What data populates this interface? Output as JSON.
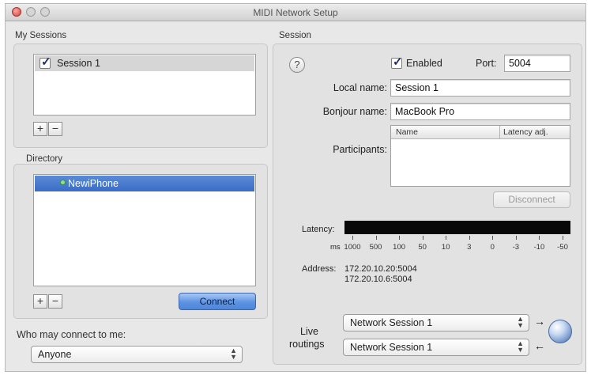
{
  "window": {
    "title": "MIDI Network Setup"
  },
  "sessions": {
    "label": "My Sessions",
    "items": [
      {
        "name": "Session 1",
        "checked": true
      }
    ],
    "add": "+",
    "remove": "−"
  },
  "directory": {
    "label": "Directory",
    "items": [
      {
        "name": "NewiPhone",
        "selected": true
      }
    ],
    "add": "+",
    "remove": "−",
    "connect_label": "Connect"
  },
  "who_connect": {
    "label": "Who may connect to me:",
    "value": "Anyone"
  },
  "session": {
    "label": "Session",
    "help": "?",
    "enabled_label": "Enabled",
    "enabled": true,
    "port_label": "Port:",
    "port_value": "5004",
    "local_name_label": "Local name:",
    "local_name_value": "Session 1",
    "bonjour_name_label": "Bonjour name:",
    "bonjour_name_value": "MacBook Pro",
    "participants_label": "Participants:",
    "participants_columns": [
      "Name",
      "Latency adj."
    ],
    "disconnect_label": "Disconnect",
    "latency_label": "Latency:",
    "latency_unit": "ms",
    "latency_ticks": [
      "1000",
      "500",
      "100",
      "50",
      "10",
      "3",
      "0",
      "-3",
      "-10",
      "-50"
    ],
    "address_label": "Address:",
    "addresses": [
      "172.20.10.20:5004",
      "172.20.10.6:5004"
    ],
    "live_routings_label_1": "Live",
    "live_routings_label_2": "routings",
    "routing_in": "Network Session 1",
    "routing_out": "Network Session 1"
  }
}
